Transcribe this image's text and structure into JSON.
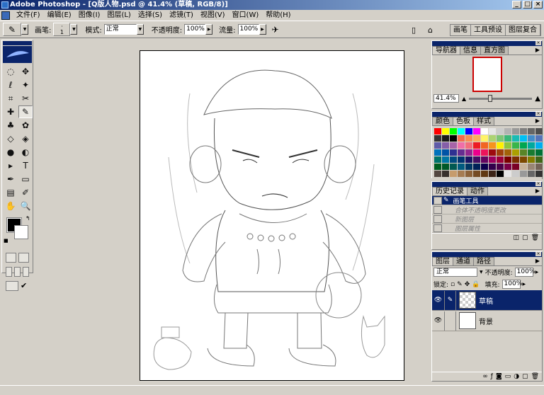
{
  "window": {
    "title": "Adobe Photoshop - [Q版人物.psd @ 41.4% (草稿, RGB/8)]",
    "buttons": [
      "_",
      "□",
      "×"
    ]
  },
  "menu": {
    "items": [
      "文件(F)",
      "编辑(E)",
      "图像(I)",
      "图层(L)",
      "选择(S)",
      "滤镜(T)",
      "视图(V)",
      "窗口(W)",
      "帮助(H)"
    ]
  },
  "options": {
    "brush_label": "画笔:",
    "brush_size": "1",
    "mode_label": "模式:",
    "mode_value": "正常",
    "opacity_label": "不透明度:",
    "opacity_value": "100%",
    "flow_label": "流量:",
    "flow_value": "100%",
    "well_tabs": [
      "画笔",
      "工具预设",
      "图层复合"
    ]
  },
  "toolbox": {
    "tools": [
      "marquee-icon",
      "move-icon",
      "lasso-icon",
      "magic-wand-icon",
      "crop-icon",
      "slice-icon",
      "healing-brush-icon",
      "brush-icon",
      "clone-stamp-icon",
      "history-brush-icon",
      "eraser-icon",
      "paint-bucket-icon",
      "blur-icon",
      "dodge-icon",
      "path-select-icon",
      "type-icon",
      "pen-icon",
      "shape-icon",
      "notes-icon",
      "eyedropper-icon",
      "hand-icon",
      "zoom-icon"
    ],
    "glyphs": [
      "◌",
      "✥",
      "ℓ",
      "✦",
      "⌗",
      "✂",
      "✚",
      "✎",
      "♣",
      "✿",
      "◇",
      "◈",
      "●",
      "◐",
      "▸",
      "T",
      "✒",
      "▭",
      "▤",
      "✐",
      "✋",
      "🔍"
    ],
    "fg_color": "#000000",
    "bg_color": "#ffffff"
  },
  "navigator": {
    "tabs": [
      "导航器",
      "信息",
      "直方图"
    ],
    "zoom": "41.4%"
  },
  "color_panel": {
    "tabs": [
      "颜色",
      "色板",
      "样式"
    ],
    "swatches": [
      "#ff0000",
      "#ffff00",
      "#00ff00",
      "#00ffff",
      "#0000ff",
      "#ff00ff",
      "#ffffff",
      "#e6e6e6",
      "#cccccc",
      "#b3b3b3",
      "#999999",
      "#808080",
      "#666666",
      "#4d4d4d",
      "#333333",
      "#1a1a1a",
      "#000000",
      "#f26c4f",
      "#f68e55",
      "#fbaf5c",
      "#fff467",
      "#acd372",
      "#7cc576",
      "#3bb878",
      "#1abbb4",
      "#00bff3",
      "#438cca",
      "#5574b9",
      "#605ca8",
      "#855fa8",
      "#a763a8",
      "#f06ea9",
      "#f26d7d",
      "#ed1c24",
      "#f26522",
      "#f7941d",
      "#fff200",
      "#8dc63f",
      "#39b54a",
      "#00a651",
      "#00a99d",
      "#00aeef",
      "#0072bc",
      "#0054a6",
      "#2e3192",
      "#662d91",
      "#92278f",
      "#ec008c",
      "#ed145b",
      "#9e0b0f",
      "#a0410d",
      "#a36209",
      "#aba000",
      "#598527",
      "#197b30",
      "#007236",
      "#00746b",
      "#0076a3",
      "#004b80",
      "#003471",
      "#1b1464",
      "#440e62",
      "#630460",
      "#9e005d",
      "#9e0039",
      "#790000",
      "#7b2e00",
      "#7d4900",
      "#827b00",
      "#406618",
      "#005e20",
      "#005826",
      "#005952",
      "#005b7f",
      "#003663",
      "#002157",
      "#0d004c",
      "#32004b",
      "#4b0049",
      "#7b0046",
      "#7a0026",
      "#c7b299",
      "#998675",
      "#736357",
      "#534741",
      "#37302d",
      "#c69c6d",
      "#a67c52",
      "#8c6239",
      "#754c24",
      "#603913",
      "#3c2415",
      "#000000",
      "#e6e6e6",
      "#cccccc",
      "#999999",
      "#666666",
      "#333333"
    ]
  },
  "history": {
    "tabs": [
      "历史记录",
      "动作"
    ],
    "items": [
      "画笔工具",
      "合体不透明度更改",
      "新图层",
      "图层属性"
    ]
  },
  "layers": {
    "tabs": [
      "图层",
      "通道",
      "路径"
    ],
    "blend_mode": "正常",
    "opacity_label": "不透明度:",
    "opacity_value": "100%",
    "lock_label": "锁定:",
    "fill_label": "填充:",
    "fill_value": "100%",
    "items": [
      "草稿",
      "背景"
    ]
  }
}
